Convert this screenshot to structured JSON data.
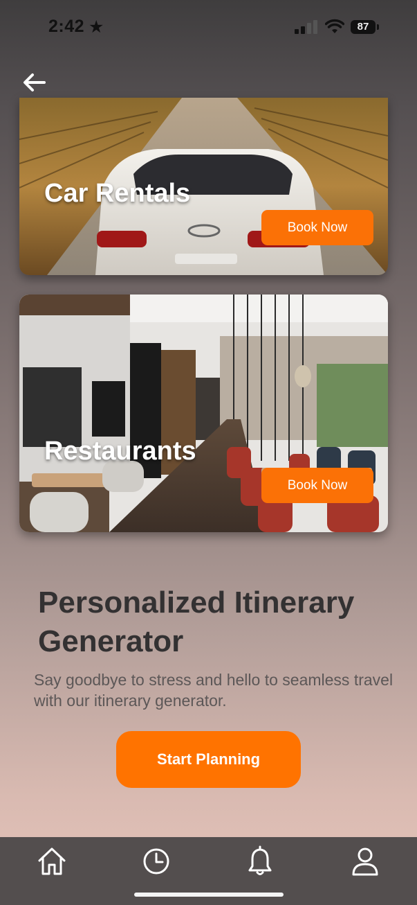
{
  "status_bar": {
    "time": "2:42",
    "battery": "87"
  },
  "cards": [
    {
      "title": "Car Rentals",
      "button_label": "Book Now"
    },
    {
      "title": "Restaurants",
      "button_label": "Book Now"
    }
  ],
  "promo": {
    "headline": "Personalized Itinerary Generator",
    "description": "Say goodbye to stress and hello to seamless travel with our itinerary generator.",
    "cta_label": "Start Planning"
  },
  "colors": {
    "accent": "#fb7106",
    "tabbar": "#534e4e",
    "headline": "#333132"
  },
  "tabbar": {
    "items": [
      {
        "icon": "home-icon"
      },
      {
        "icon": "history-clock-icon"
      },
      {
        "icon": "bell-icon"
      },
      {
        "icon": "profile-icon"
      }
    ]
  }
}
